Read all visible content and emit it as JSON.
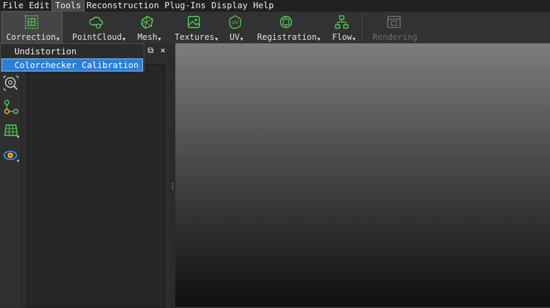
{
  "menubar": {
    "items": [
      {
        "label": "File"
      },
      {
        "label": "Edit"
      },
      {
        "label": "Tools"
      },
      {
        "label": "Reconstruction"
      },
      {
        "label": "Plug-Ins"
      },
      {
        "label": "Display"
      },
      {
        "label": "Help"
      }
    ],
    "active": "Tools"
  },
  "toolbar": {
    "buttons": [
      {
        "label": "Correction",
        "icon": "correction-grid-icon",
        "state": "pressed"
      },
      {
        "label": "PointCloud",
        "icon": "point-cloud-icon"
      },
      {
        "label": "Mesh",
        "icon": "mesh-icon"
      },
      {
        "label": "Textures",
        "icon": "texture-icon"
      },
      {
        "label": "UV",
        "icon": "uv-icon"
      },
      {
        "label": "Registration",
        "icon": "registration-icon"
      },
      {
        "label": "Flow",
        "icon": "flow-icon"
      },
      {
        "label": "Rendering",
        "icon": "rendering-icon",
        "state": "disabled"
      }
    ],
    "dropdown_arrow": "▼"
  },
  "dropdown": {
    "items": [
      {
        "label": "Undistortion"
      },
      {
        "label": "Colorchecker Calibration",
        "highlighted": true
      }
    ]
  },
  "side_tools": [
    {
      "icon": "zoom-target-icon"
    },
    {
      "icon": "node-graph-icon"
    },
    {
      "icon": "grid-plane-icon"
    },
    {
      "icon": "color-eye-icon"
    }
  ],
  "panel": {
    "buttons": [
      {
        "glyph": "⧉",
        "icon": "restore-panel-icon"
      },
      {
        "glyph": "✕",
        "icon": "close-panel-icon"
      }
    ]
  },
  "colors": {
    "accent_green": "#56d65a",
    "highlight_blue": "#2b7fd6",
    "disabled_text": "#6c6c6c"
  }
}
